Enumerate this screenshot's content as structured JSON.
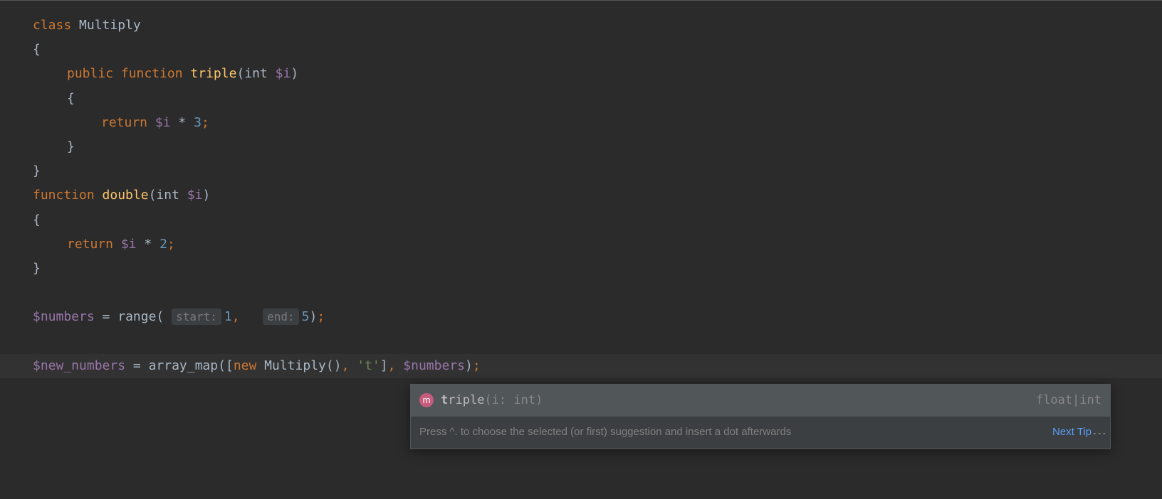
{
  "code": {
    "class_kw": "class",
    "class_name": "Multiply",
    "open_brace": "{",
    "close_brace": "}",
    "public_kw": "public",
    "function_kw": "function",
    "method_name": "triple",
    "param_open": "(",
    "param_close": ")",
    "int_type": "int",
    "param_var": "$i",
    "return_kw": "return",
    "mul_op": "*",
    "three": "3",
    "semi": ";",
    "func2_kw": "function",
    "func2_name": "double",
    "two": "2",
    "numbers_var": "$numbers",
    "equals": "=",
    "range_fn": "range",
    "hint_start": "start:",
    "range_start": "1",
    "comma": ",",
    "hint_end": "end:",
    "range_end": "5",
    "new_numbers_var": "$new_numbers",
    "array_map_fn": "array_map",
    "bracket_open": "[",
    "new_kw": "new",
    "multiply_ctor": "Multiply",
    "empty_args": "()",
    "str_t": "'t'",
    "bracket_close": "]",
    "numbers_arg": "$numbers"
  },
  "completion": {
    "icon_letter": "m",
    "name_prefix": "t",
    "name_rest": "riple",
    "params": "(i: int)",
    "return_type": "float|int"
  },
  "tip": {
    "text": "Press ^. to choose the selected (or first) suggestion and insert a dot afterwards",
    "next_label": "Next Tip"
  }
}
